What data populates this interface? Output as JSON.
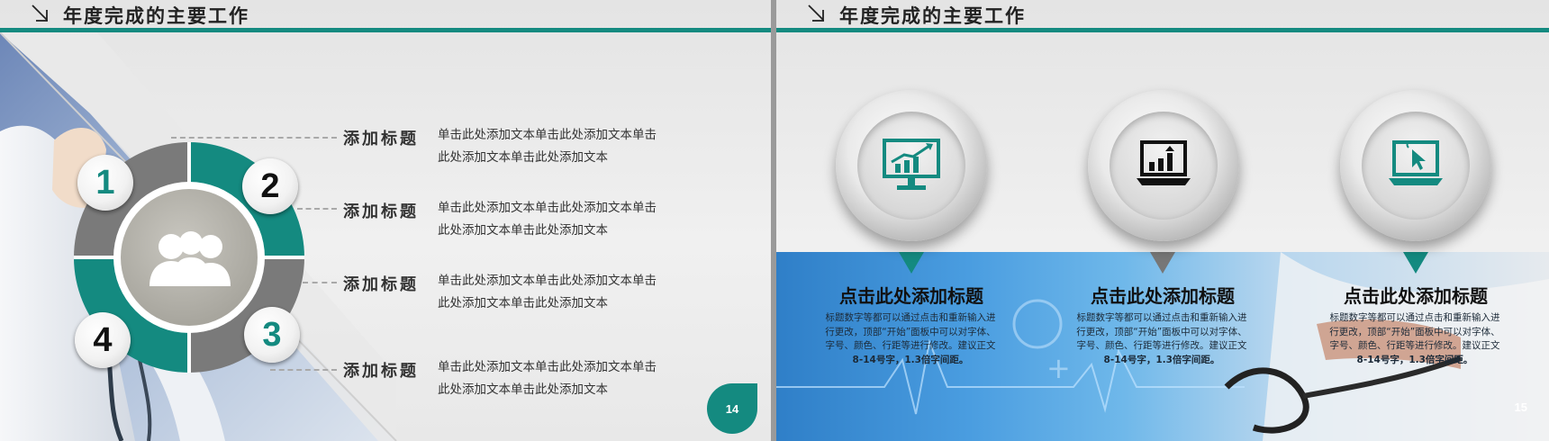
{
  "colors": {
    "accent": "#148a80",
    "dark_segment": "#7a7a7a",
    "text": "#333333"
  },
  "slide_14": {
    "header_title": "年度完成的主要工作",
    "center_icon": "group-people-icon",
    "badges": [
      "1",
      "2",
      "3",
      "4"
    ],
    "items": [
      {
        "title": "添加标题",
        "desc": "单击此处添加文本单击此处添加文本单击此处添加文本单击此处添加文本"
      },
      {
        "title": "添加标题",
        "desc": "单击此处添加文本单击此处添加文本单击此处添加文本单击此处添加文本"
      },
      {
        "title": "添加标题",
        "desc": "单击此处添加文本单击此处添加文本单击此处添加文本单击此处添加文本"
      },
      {
        "title": "添加标题",
        "desc": "单击此处添加文本单击此处添加文本单击此处添加文本单击此处添加文本"
      }
    ],
    "page_number": "14"
  },
  "slide_15": {
    "header_title": "年度完成的主要工作",
    "columns": [
      {
        "icon": "monitor-chart-icon",
        "title": "点击此处添加标题",
        "desc": "标题数字等都可以通过点击和重新输入进行更改，顶部“开始”面板中可以对字体、字号、颜色、行距等进行修改。建议正文",
        "desc_emphasis": "8-14号字，1.3倍字间距。"
      },
      {
        "icon": "laptop-chart-icon",
        "title": "点击此处添加标题",
        "desc": "标题数字等都可以通过点击和重新输入进行更改，顶部“开始”面板中可以对字体、字号、颜色、行距等进行修改。建议正文",
        "desc_emphasis": "8-14号字，1.3倍字间距。"
      },
      {
        "icon": "laptop-cursor-icon",
        "title": "点击此处添加标题",
        "desc": "标题数字等都可以通过点击和重新输入进行更改，顶部“开始”面板中可以对字体、字号、颜色、行距等进行修改。建议正文",
        "desc_emphasis": "8-14号字，1.3倍字间距。"
      }
    ],
    "page_number": "15"
  }
}
